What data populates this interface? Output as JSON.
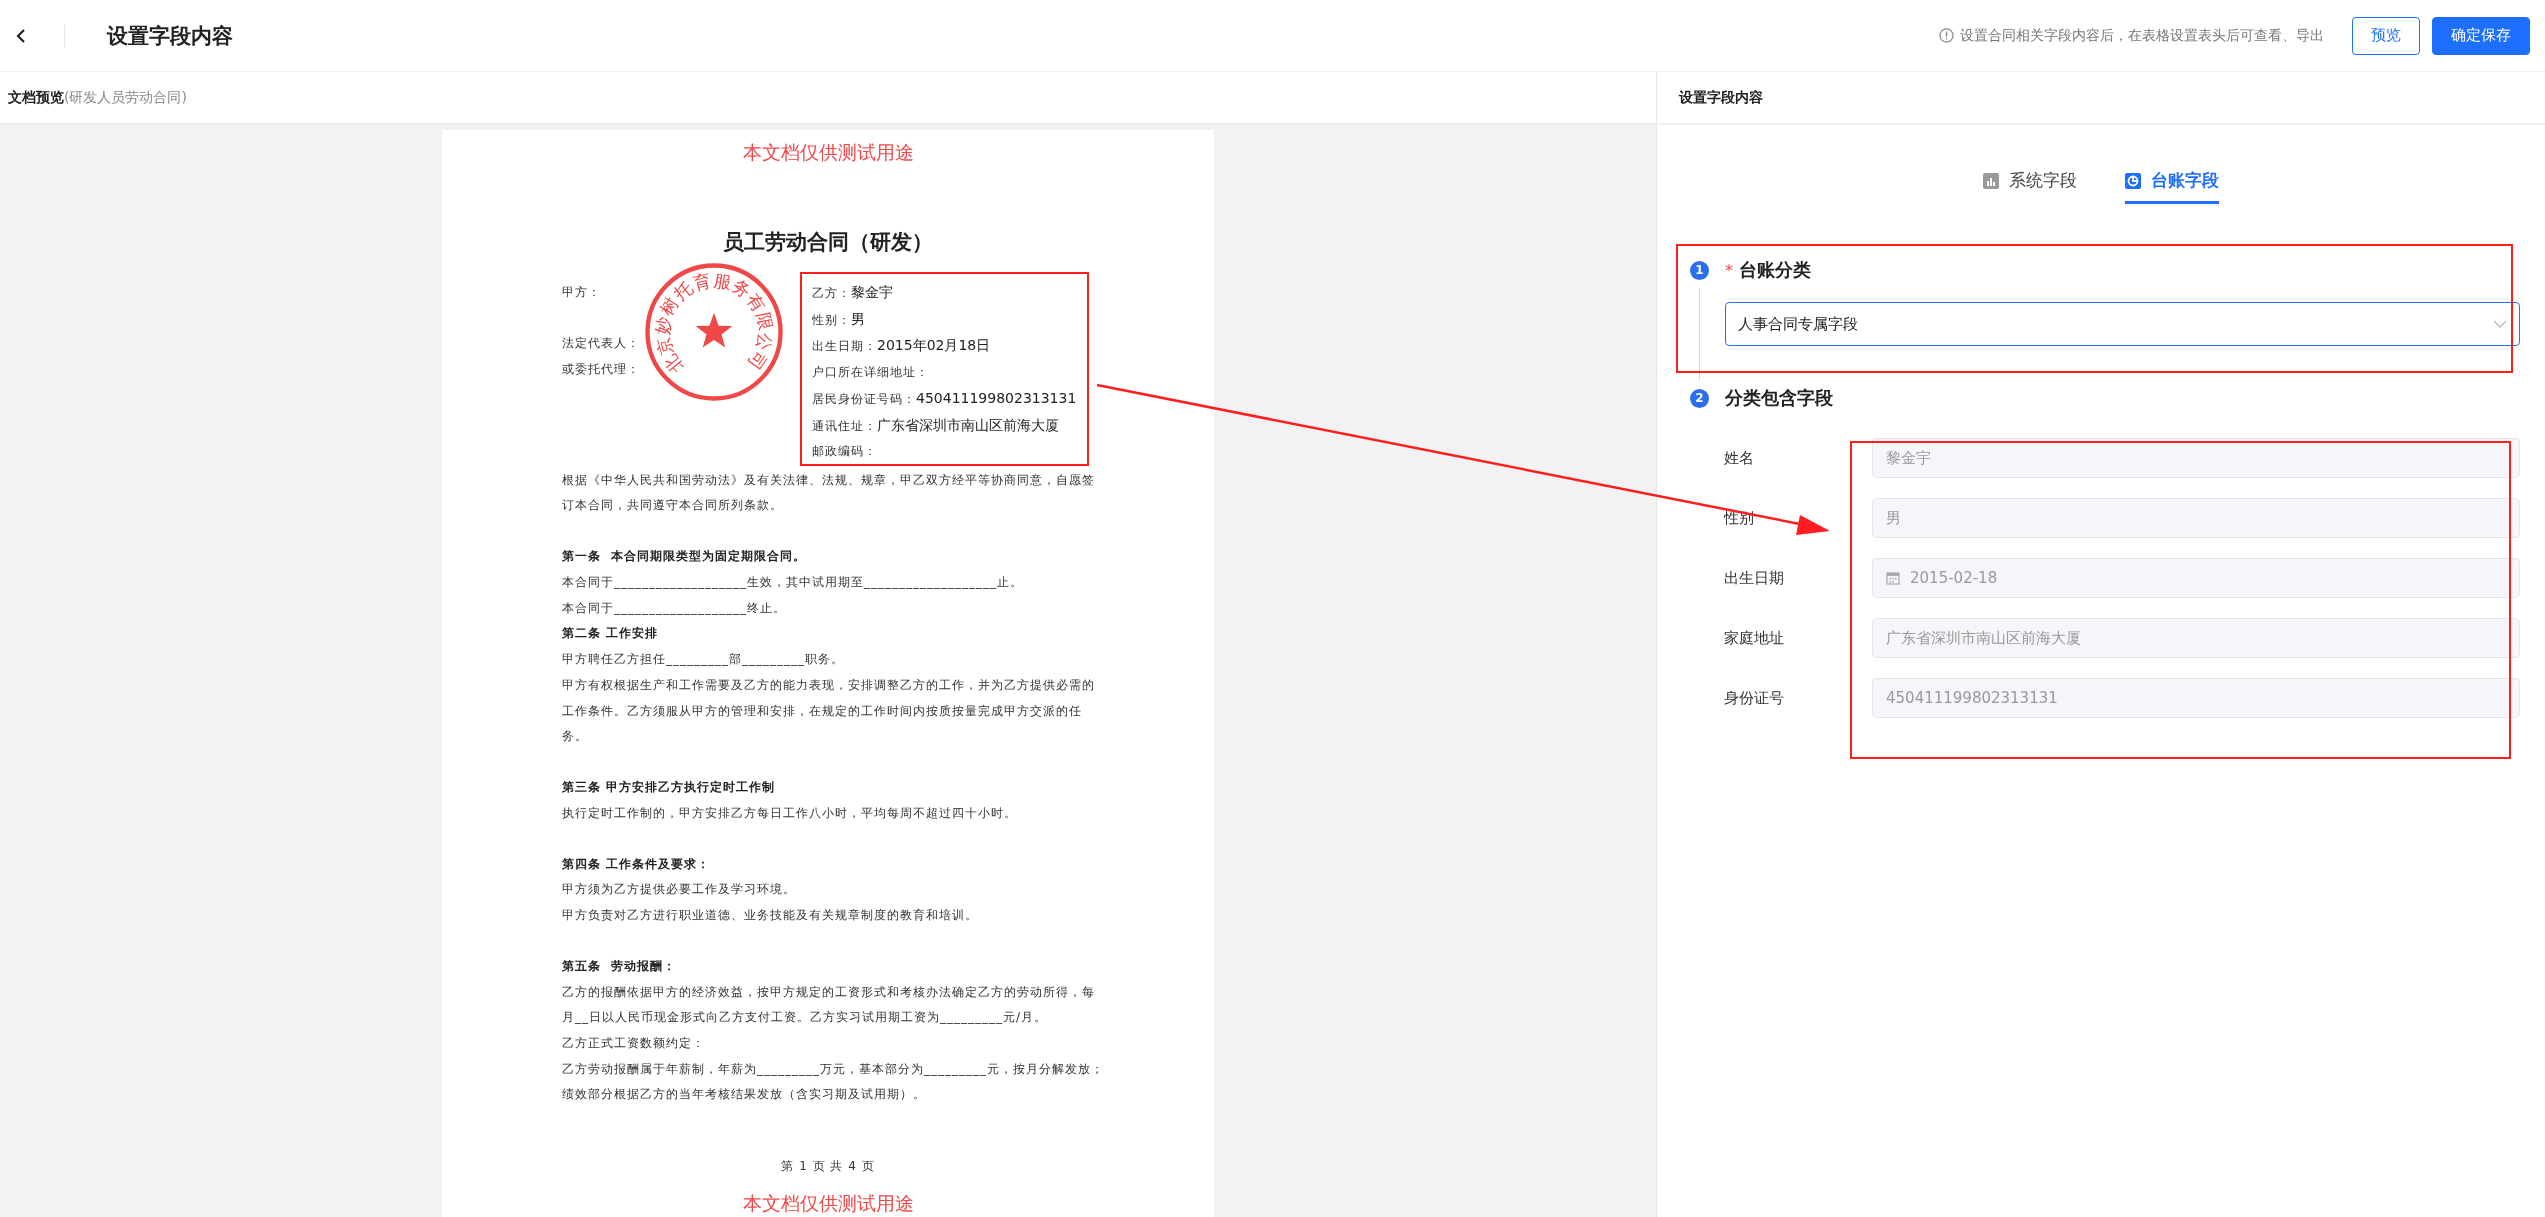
{
  "header": {
    "title": "设置字段内容",
    "notice": "设置合同相关字段内容后，在表格设置表头后可查看、导出",
    "buttons": [
      {
        "label": "预览",
        "kind": "secondary"
      },
      {
        "label": "确定保存",
        "kind": "primary"
      }
    ]
  },
  "preview": {
    "title": "文档预览",
    "subtitle": "(研发人员劳动合同)"
  },
  "document": {
    "watermark_top": "本文档仅供测试用途",
    "title": "员工劳动合同（研发）",
    "stamp": "北京妙树托育服务有限公司",
    "party_a": [
      "甲方：",
      "法定代表人：",
      "或委托代理："
    ],
    "party_b": [
      {
        "label": "乙方：",
        "value": "黎金宇"
      },
      {
        "label": "性别：",
        "value": "男"
      },
      {
        "label": "出生日期：",
        "value": "2015年02月18日"
      },
      {
        "label": "户口所在详细地址："
      },
      {
        "label": "居民身份证号码：",
        "value": "450411199802313131"
      },
      {
        "label": "通讯住址：",
        "value": "广东省深圳市南山区前海大厦"
      },
      {
        "label": "邮政编码："
      }
    ],
    "blocks": [
      {
        "kind": "line",
        "text": "根据《中华人民共和国劳动法》及有关法律、法规、规章，甲乙双方经平等协商同意，自愿签订本合同，共同遵守本合同所列条款。"
      },
      {
        "kind": "blank"
      },
      {
        "kind": "heading",
        "text": "第一条  本合同期限类型为固定期限合同。"
      },
      {
        "kind": "line",
        "text": "本合同于___________________生效，其中试用期至___________________止。"
      },
      {
        "kind": "line",
        "text": "本合同于___________________终止。"
      },
      {
        "kind": "heading",
        "text": "第二条 工作安排"
      },
      {
        "kind": "line",
        "text": "甲方聘任乙方担任_________部_________职务。"
      },
      {
        "kind": "line",
        "text": "甲方有权根据生产和工作需要及乙方的能力表现，安排调整乙方的工作，并为乙方提供必需的工作条件。乙方须服从甲方的管理和安排，在规定的工作时间内按质按量完成甲方交派的任务。"
      },
      {
        "kind": "blank"
      },
      {
        "kind": "heading",
        "text": "第三条 甲方安排乙方执行定时工作制"
      },
      {
        "kind": "line",
        "text": "执行定时工作制的，甲方安排乙方每日工作八小时，平均每周不超过四十小时。"
      },
      {
        "kind": "blank"
      },
      {
        "kind": "heading",
        "text": "第四条 工作条件及要求："
      },
      {
        "kind": "line",
        "text": "甲方须为乙方提供必要工作及学习环境。"
      },
      {
        "kind": "line",
        "text": "甲方负责对乙方进行职业道德、业务技能及有关规章制度的教育和培训。"
      },
      {
        "kind": "blank"
      },
      {
        "kind": "heading",
        "text": "第五条  劳动报酬："
      },
      {
        "kind": "line",
        "text": "乙方的报酬依据甲方的经济效益，按甲方规定的工资形式和考核办法确定乙方的劳动所得，每月__日以人民币现金形式向乙方支付工资。乙方实习试用期工资为_________元/月。"
      },
      {
        "kind": "line",
        "text": "乙方正式工资数额约定："
      },
      {
        "kind": "line",
        "text": "乙方劳动报酬属于年薪制，年薪为_________万元，基本部分为_________元，按月分解发放；绩效部分根据乙方的当年考核结果发放（含实习期及试用期）。"
      }
    ],
    "page_number": "第 1 页 共 4 页",
    "watermark_bottom": "本文档仅供测试用途"
  },
  "settings": {
    "title": "设置字段内容",
    "tabs": [
      {
        "label": "系统字段",
        "selected": false
      },
      {
        "label": "台账字段",
        "selected": true
      }
    ],
    "category": {
      "step": "1",
      "required": "*",
      "label": "台账分类",
      "value": "人事合同专属字段"
    },
    "fields_step": {
      "step": "2",
      "label": "分类包含字段",
      "fields": [
        {
          "label": "姓名",
          "value": "黎金宇",
          "kind": "text",
          "disabled": true
        },
        {
          "label": "性别",
          "value": "男",
          "kind": "text",
          "disabled": true
        },
        {
          "label": "出生日期",
          "value": "2015-02-18",
          "kind": "date",
          "disabled": true
        },
        {
          "label": "家庭地址",
          "value": "广东省深圳市南山区前海大厦",
          "kind": "text",
          "disabled": true
        },
        {
          "label": "身份证号",
          "value": "450411199802313131",
          "kind": "text",
          "disabled": true
        }
      ]
    }
  }
}
